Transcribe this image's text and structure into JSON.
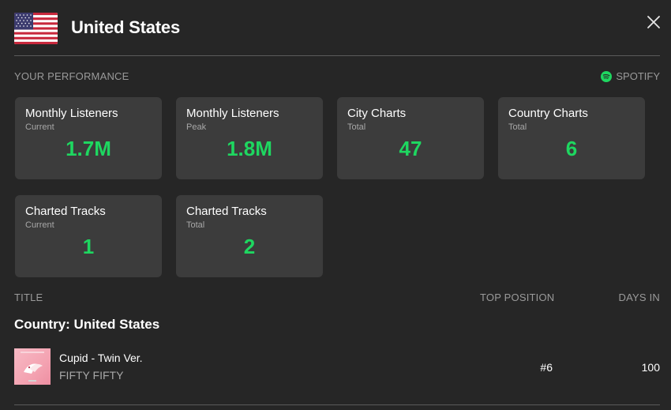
{
  "header": {
    "country": "United States",
    "flag_icon": "us-flag-icon",
    "close_icon": "close-icon"
  },
  "performance": {
    "label": "YOUR PERFORMANCE",
    "source": "SPOTIFY",
    "source_color": "#1ed760",
    "cards": [
      {
        "title": "Monthly Listeners",
        "subtitle": "Current",
        "value": "1.7M"
      },
      {
        "title": "Monthly Listeners",
        "subtitle": "Peak",
        "value": "1.8M"
      },
      {
        "title": "City Charts",
        "subtitle": "Total",
        "value": "47"
      },
      {
        "title": "Country Charts",
        "subtitle": "Total",
        "value": "6"
      },
      {
        "title": "Charted Tracks",
        "subtitle": "Current",
        "value": "1"
      },
      {
        "title": "Charted Tracks",
        "subtitle": "Total",
        "value": "2"
      }
    ]
  },
  "table": {
    "columns": {
      "title": "TITLE",
      "top_position": "TOP POSITION",
      "days_in": "DAYS IN"
    },
    "group": "Country: United States",
    "rows": [
      {
        "track": "Cupid - Twin Ver.",
        "artist": "FIFTY FIFTY",
        "top_position": "#6",
        "days_in": "100"
      }
    ]
  }
}
